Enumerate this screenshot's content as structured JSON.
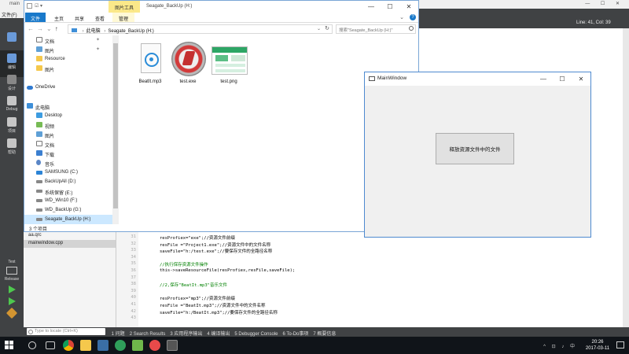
{
  "qt": {
    "window_title": "main",
    "menu_first": "文件(F)",
    "modes": [
      {
        "label": "",
        "active": false
      },
      {
        "label": "编辑",
        "active": true
      },
      {
        "label": "设计",
        "active": false
      },
      {
        "label": "Debug",
        "active": false
      },
      {
        "label": "项目",
        "active": false
      },
      {
        "label": "帮助",
        "active": false
      }
    ],
    "editor_status": "Line: 41, Col: 39",
    "open_documents": [
      "aa.qrc",
      "mainwindow.cpp"
    ],
    "selected_document": "mainwindow.cpp",
    "line_numbers": [
      "31",
      "32",
      "33",
      "34",
      "35",
      "36",
      "37",
      "38",
      "39",
      "40",
      "41",
      "42",
      "43"
    ],
    "code_lines": [
      {
        "text": "resProfiex=\"exe\";//资源文件前缀",
        "kind": "plain"
      },
      {
        "text": "resFile =\"Project1.exe\";//资源文件中的文件名称",
        "kind": "plain"
      },
      {
        "text": "saveFile=\"h:/test.exe\";//要保存文件的全路径名称",
        "kind": "plain"
      },
      {
        "text": "",
        "kind": "plain"
      },
      {
        "text": "//执行保存资源文件操作",
        "kind": "com"
      },
      {
        "text": "this->saveResourceFile(resProfiex,resFile,saveFile);",
        "kind": "plain"
      },
      {
        "text": "",
        "kind": "plain"
      },
      {
        "text": "//2,保存\"BeatIt.mp3\"音乐文件",
        "kind": "com"
      },
      {
        "text": "",
        "kind": "plain"
      },
      {
        "text": "resProfiex=\"mp3\";//资源文件前缀",
        "kind": "plain"
      },
      {
        "text": "resFile =\"BeatIt.mp3\";//资源文件中的文件名称",
        "kind": "plain"
      },
      {
        "text": "saveFile=\"h:/BeatIt.mp3\";//要保存文件的全路径名称",
        "kind": "plain"
      },
      {
        "text": "",
        "kind": "plain"
      }
    ],
    "run_target_label": "Test",
    "run_config_label": "Release",
    "locator_placeholder": "Type to locate (Ctrl+K)",
    "output_panes": [
      "1 问题",
      "2 Search Results",
      "3 应用程序输出",
      "4 编译输出",
      "5 Debugger Console",
      "6 To-Do事项",
      "7 概要信息"
    ]
  },
  "explorer": {
    "quick_access_toolbar": "☑ ▾",
    "context_tab": "图片工具",
    "title": "Seagate_BackUp (H:)",
    "ribbon_tabs": [
      "文件",
      "主页",
      "共享",
      "查看",
      "管理"
    ],
    "address_path": [
      "此电脑",
      "Seagate_BackUp (H:)"
    ],
    "search_placeholder": "搜索\"Seagate_BackUp (H:)\"",
    "nav_items": [
      {
        "label": "文档",
        "icon": "doc",
        "pinned": true,
        "level": 1
      },
      {
        "label": "图片",
        "icon": "pic",
        "pinned": true,
        "level": 1
      },
      {
        "label": "Resource",
        "icon": "folder",
        "pinned": false,
        "level": 1
      },
      {
        "label": "图片",
        "icon": "folder",
        "pinned": false,
        "level": 1
      },
      {
        "label": "",
        "icon": "",
        "pinned": false,
        "level": 1
      },
      {
        "label": "OneDrive",
        "icon": "cloud",
        "pinned": false,
        "level": 0
      },
      {
        "label": "",
        "icon": "",
        "pinned": false,
        "level": 1
      },
      {
        "label": "此电脑",
        "icon": "pc",
        "pinned": false,
        "level": 0
      },
      {
        "label": "Desktop",
        "icon": "desktop",
        "pinned": false,
        "level": 1
      },
      {
        "label": "视频",
        "icon": "video",
        "pinned": false,
        "level": 1
      },
      {
        "label": "图片",
        "icon": "pic",
        "pinned": false,
        "level": 1
      },
      {
        "label": "文档",
        "icon": "doc",
        "pinned": false,
        "level": 1
      },
      {
        "label": "下载",
        "icon": "download",
        "pinned": false,
        "level": 1
      },
      {
        "label": "音乐",
        "icon": "music",
        "pinned": false,
        "level": 1
      },
      {
        "label": "SAMSUNG (C:)",
        "icon": "winDrive",
        "pinned": false,
        "level": 1
      },
      {
        "label": "BackUpAll (D:)",
        "icon": "drive",
        "pinned": false,
        "level": 1
      },
      {
        "label": "系统保留 (E:)",
        "icon": "drive",
        "pinned": false,
        "level": 1
      },
      {
        "label": "WD_Win10 (F:)",
        "icon": "drive",
        "pinned": false,
        "level": 1
      },
      {
        "label": "WD_BackUp (G:)",
        "icon": "drive",
        "pinned": false,
        "level": 1
      },
      {
        "label": "Seagate_BackUp (H:)",
        "icon": "drive",
        "pinned": false,
        "level": 1,
        "selected": true
      },
      {
        "label": "",
        "icon": "",
        "pinned": false,
        "level": 1
      },
      {
        "label": "网络",
        "icon": "net",
        "pinned": false,
        "level": 0
      }
    ],
    "status_text": "3 个项目",
    "files": [
      {
        "name": "BeatIt.mp3",
        "type": "mp3"
      },
      {
        "name": "test.exe",
        "type": "exe"
      },
      {
        "name": "test.png",
        "type": "png"
      }
    ]
  },
  "mainwindow": {
    "title": "MainWindow",
    "button_label": "释放资源文件中的文件"
  },
  "taskbar": {
    "time": "20:26",
    "date": "2017-03-11",
    "tray_text": "^ ⊡ ♪ 中"
  },
  "colors": {
    "qt_sidebar": "#404244",
    "explorer_accent": "#1979ca",
    "context_tab": "#fbe889",
    "selection": "#cce8ff",
    "taskbar": "#101419"
  }
}
